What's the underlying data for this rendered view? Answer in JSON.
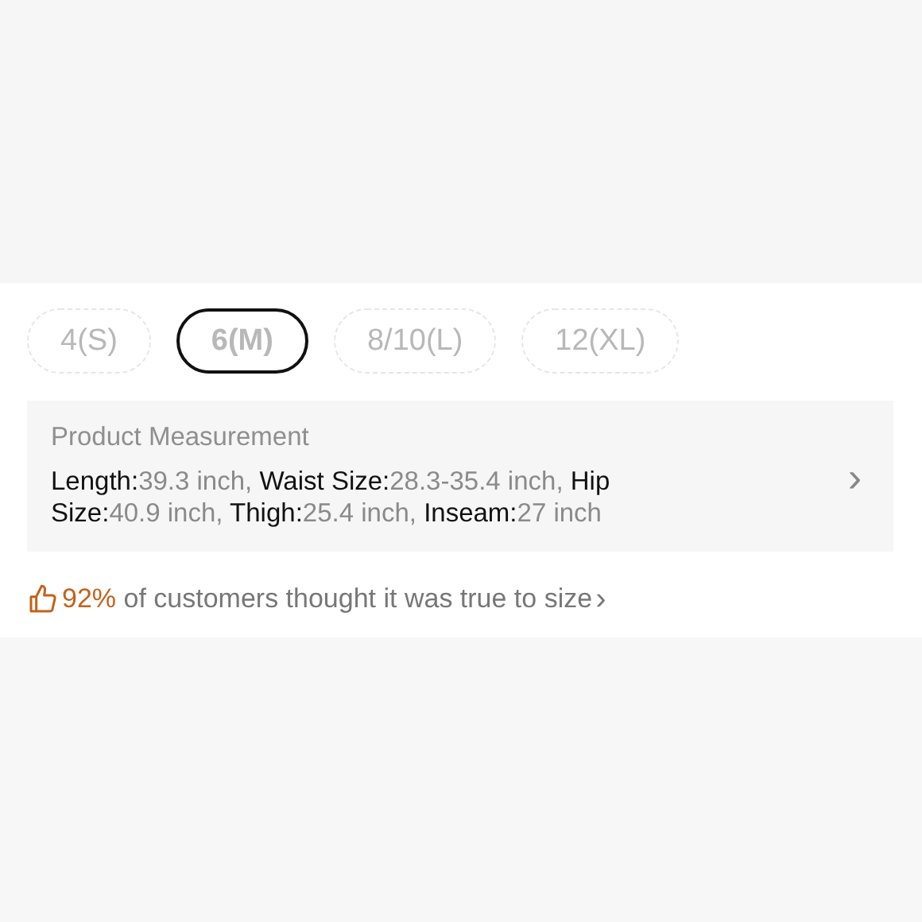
{
  "sizes": [
    {
      "label": "4(S)",
      "selected": false
    },
    {
      "label": "6(M)",
      "selected": true
    },
    {
      "label": "8/10(L)",
      "selected": false
    },
    {
      "label": "12(XL)",
      "selected": false
    }
  ],
  "measurement": {
    "title": "Product Measurement",
    "items": [
      {
        "name": "Length:",
        "value": "39.3 inch,"
      },
      {
        "name": "Waist Size:",
        "value": "28.3-35.4 inch,"
      },
      {
        "name": "Hip Size:",
        "value": "40.9 inch,"
      },
      {
        "name": "Thigh:",
        "value": "25.4 inch,"
      },
      {
        "name": "Inseam:",
        "value": "27 inch"
      }
    ],
    "chevron": "›"
  },
  "fit": {
    "percent": "92%",
    "text": "of customers thought it was true to size",
    "chevron": "›"
  }
}
